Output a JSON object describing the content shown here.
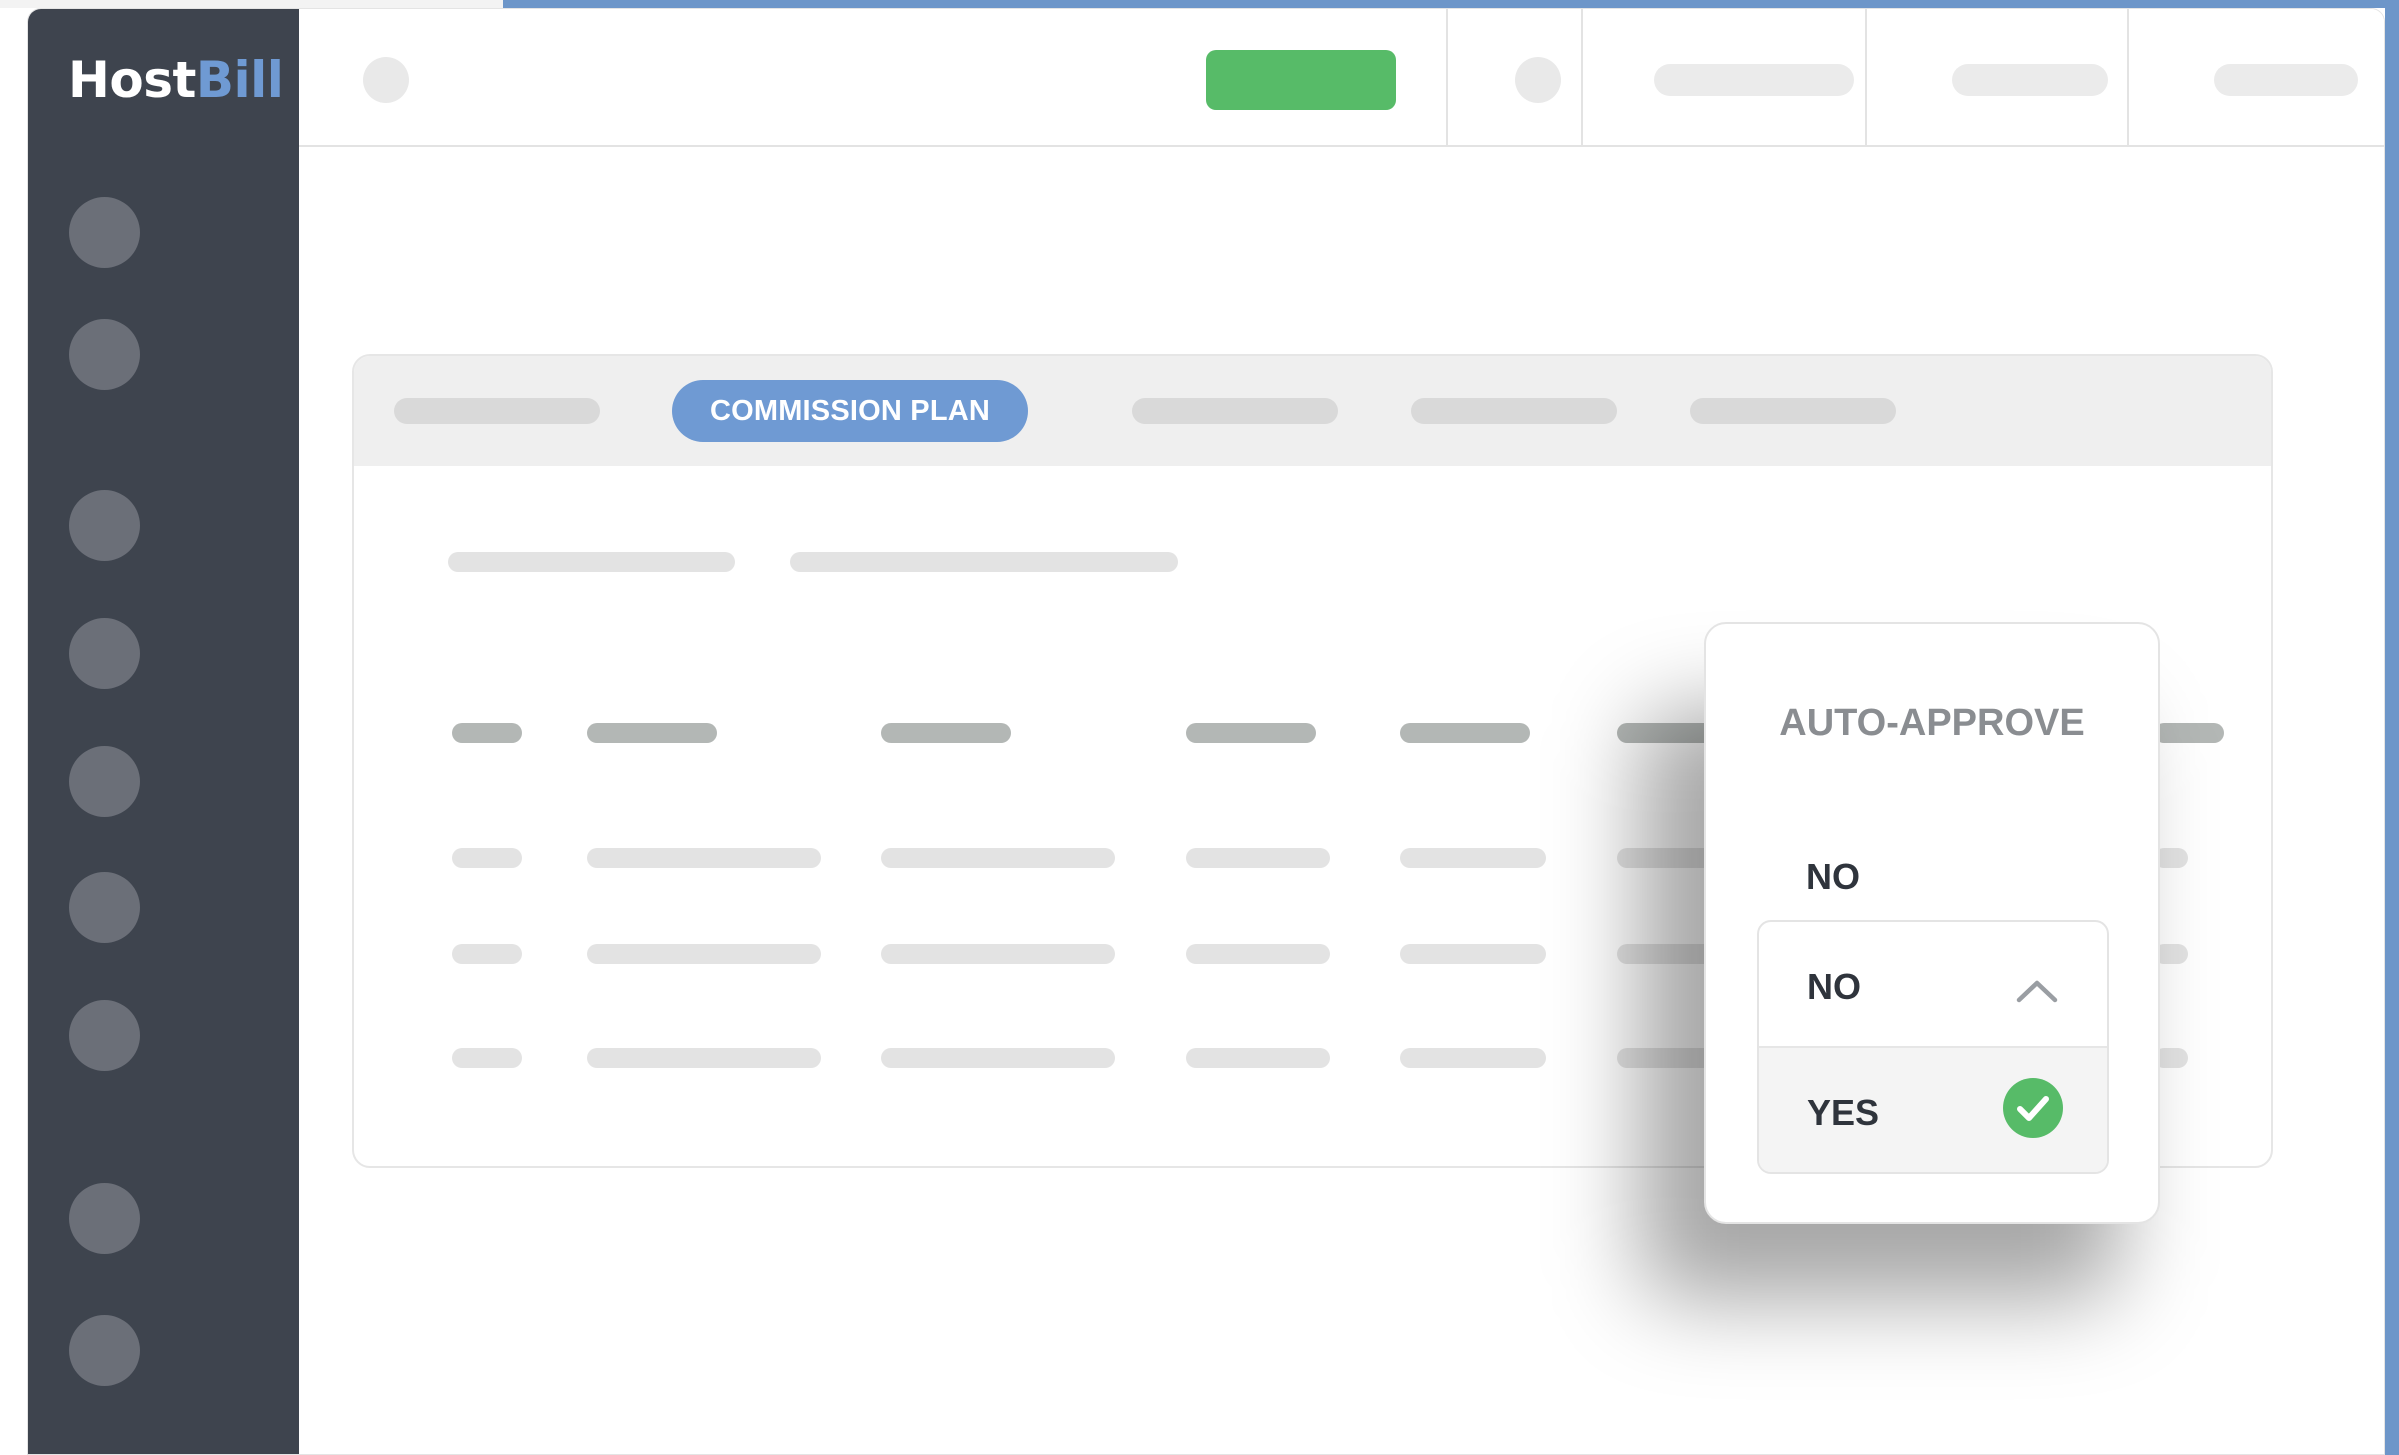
{
  "brand": {
    "logo_part1": "Host",
    "logo_part2": "Bill",
    "accent_color": "#6f9ad3",
    "sidebar_color": "#3e444e",
    "success_color": "#57bb68"
  },
  "tabs": {
    "active_label": "COMMISSION PLAN"
  },
  "auto_approve": {
    "title": "AUTO-APPROVE",
    "current_value": "NO",
    "options": [
      {
        "label": "NO",
        "icon": "chevron-up-icon"
      },
      {
        "label": "YES",
        "icon": "check-circle-icon",
        "selected": true
      }
    ]
  }
}
